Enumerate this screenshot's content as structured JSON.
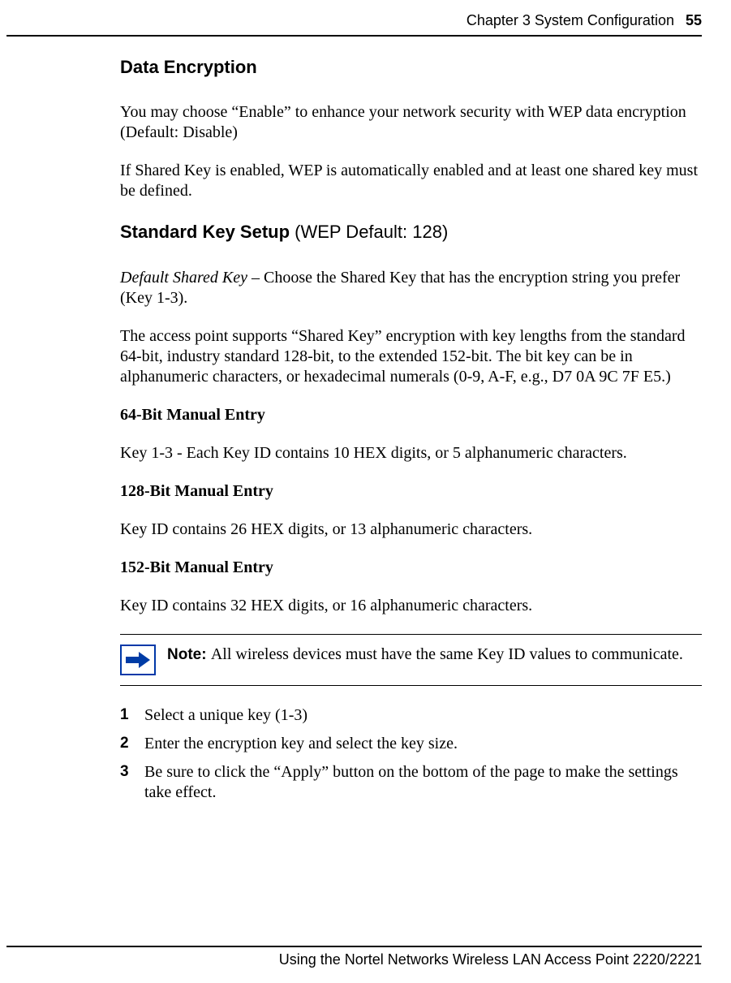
{
  "header": {
    "chapter": "Chapter 3  System Configuration",
    "page": "55"
  },
  "sections": {
    "data_encryption": {
      "title": "Data Encryption",
      "p1": "You may choose “Enable” to enhance your network security with WEP data encryption",
      "p1b": "(Default: Disable)",
      "p2": "If Shared Key is enabled, WEP is automatically enabled and at least one shared key must be defined."
    },
    "standard_key": {
      "title_bold": "Standard Key Setup ",
      "title_rest": "(WEP Default: 128)",
      "p1_italic": "Default Shared Key",
      "p1_rest": " – Choose the Shared Key that has the encryption string you prefer (Key 1-3).",
      "p2": "The access point supports “Shared Key” encryption with key lengths from the standard 64-bit, industry standard 128-bit, to the extended 152-bit. The bit key can be in alphanumeric characters, or hexadecimal numerals (0-9, A-F, e.g., D7 0A 9C 7F E5.)",
      "h64": "64-Bit Manual Entry",
      "p64": "Key 1-3 - Each Key ID contains 10 HEX digits, or 5 alphanumeric characters.",
      "h128": "128-Bit Manual Entry",
      "p128": "Key ID contains 26 HEX digits, or 13 alphanumeric characters.",
      "h152": "152-Bit Manual Entry",
      "p152": "Key ID contains 32 HEX digits, or 16 alphanumeric characters."
    },
    "note": {
      "label": "Note: ",
      "text": "All wireless devices must have the same Key ID values to communicate."
    },
    "steps": [
      "Select a unique key (1-3)",
      "Enter the encryption key and select the key size.",
      "Be sure to click the “Apply” button on the bottom of the page to make the settings take effect."
    ]
  },
  "footer": "Using the Nortel Networks Wireless LAN Access Point 2220/2221"
}
